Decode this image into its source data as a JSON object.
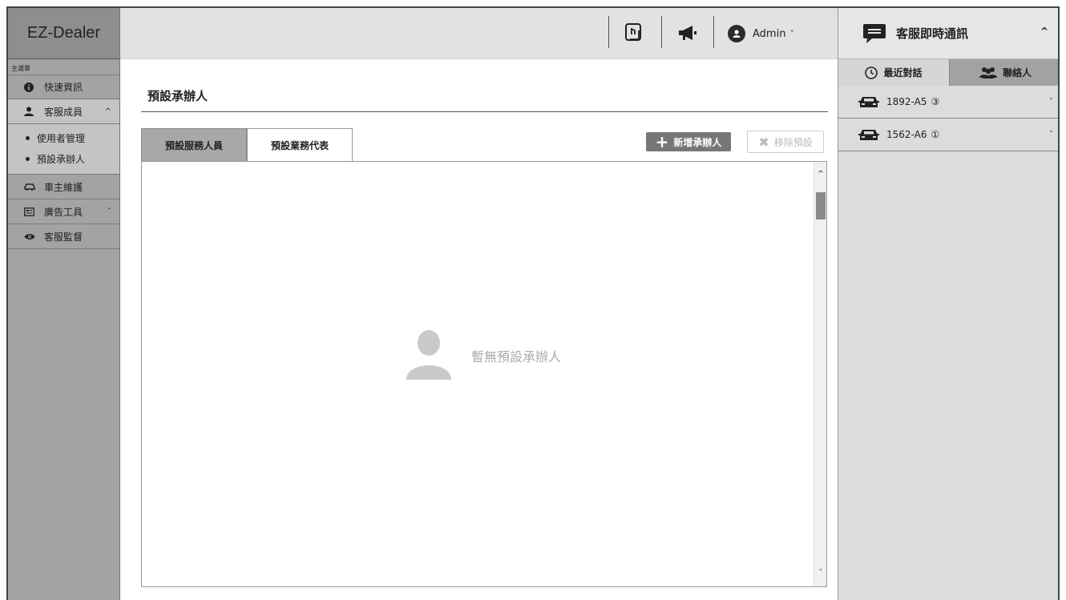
{
  "brand": "EZ-Dealer",
  "sidebar": {
    "caption": "主選單",
    "items": [
      {
        "label": "快速資訊",
        "icon": "info-icon"
      },
      {
        "label": "客服成員",
        "icon": "person-icon",
        "chevron": "^"
      },
      {
        "label": "車主維護",
        "icon": "car-icon"
      },
      {
        "label": "廣告工具",
        "icon": "ad-icon",
        "chevron": "ˇ"
      },
      {
        "label": "客服監督",
        "icon": "eye-icon"
      }
    ],
    "sub_items": [
      {
        "label": "使用者管理"
      },
      {
        "label": "預設承辦人"
      }
    ]
  },
  "topbar": {
    "user": "Admin",
    "user_chevron": "ˇ"
  },
  "main": {
    "title": "預設承辦人",
    "tabs": [
      {
        "label": "預設服務人員",
        "active": true
      },
      {
        "label": "預設業務代表",
        "active": false
      }
    ],
    "add_button": "新增承辦人",
    "remove_button": "移除預設",
    "empty_text": "暫無預設承辦人",
    "scroll_up": "^",
    "scroll_down": "ˇ"
  },
  "chat": {
    "title": "客服即時通訊",
    "collapse": "^",
    "tabs": [
      {
        "label": "最近對話",
        "icon": "clock-icon",
        "active": true
      },
      {
        "label": "聯絡人",
        "icon": "group-icon",
        "active": false
      }
    ],
    "conversations": [
      {
        "plate": "1892-A5",
        "badge": "③",
        "chevron": "ˇ"
      },
      {
        "plate": "1562-A6",
        "badge": "①",
        "chevron": "ˇ"
      }
    ]
  },
  "colors": {
    "sidebar_bg": "#a3a3a3",
    "active_tab": "#a8a8a8",
    "primary_button": "#777777",
    "chat_bg": "#dcdcdc"
  }
}
